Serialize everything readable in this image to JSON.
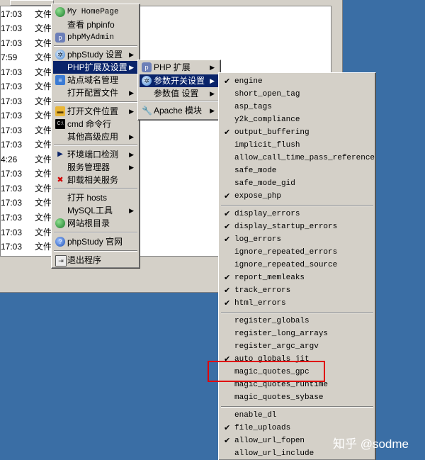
{
  "background": {
    "rows": [
      {
        "time": "17:03",
        "type": "文件"
      },
      {
        "time": "17:03",
        "type": "文件"
      },
      {
        "time": "17:03",
        "type": "文件"
      },
      {
        "time": "7:59",
        "type": "文件"
      },
      {
        "time": "17:03",
        "type": "文件"
      },
      {
        "time": "17:03",
        "type": "文件"
      },
      {
        "time": "17:03",
        "type": "文件"
      },
      {
        "time": "17:03",
        "type": "文件"
      },
      {
        "time": "17:03",
        "type": "文件"
      },
      {
        "time": "17:03",
        "type": "文件"
      },
      {
        "time": "4:26",
        "type": "文件"
      },
      {
        "time": "17:03",
        "type": "文件"
      },
      {
        "time": "17:03",
        "type": "文件"
      },
      {
        "time": "17:03",
        "type": "文件"
      },
      {
        "time": "17:03",
        "type": "文件"
      },
      {
        "time": "17:03",
        "type": "文件"
      },
      {
        "time": "17:03",
        "type": "文件"
      }
    ]
  },
  "main_menu": {
    "items": [
      {
        "label": "My HomePage",
        "icon": "globe-icon"
      },
      {
        "label": "查看 phpinfo",
        "icon": ""
      },
      {
        "label": "phpMyAdmin",
        "icon": "php-icon"
      },
      {
        "label": "phpStudy 设置",
        "icon": "gear-icon",
        "sub": true
      },
      {
        "label": "PHP扩展及设置",
        "icon": "",
        "sub": true,
        "highlight": true
      },
      {
        "label": "站点域名管理",
        "icon": "server-icon"
      },
      {
        "label": "打开配置文件",
        "icon": "",
        "sub": true
      },
      {
        "label": "打开文件位置",
        "icon": "folder-icon",
        "sub": true
      },
      {
        "label": "cmd 命令行",
        "icon": "cmd-icon"
      },
      {
        "label": "其他高级应用",
        "icon": "",
        "sub": true
      },
      {
        "label": "环境端口检测",
        "icon": "play-icon",
        "sub": true
      },
      {
        "label": "服务管理器",
        "icon": "",
        "sub": true
      },
      {
        "label": "卸载相关服务",
        "icon": "uninstall-icon"
      },
      {
        "label": "打开 hosts",
        "icon": ""
      },
      {
        "label": "MySQL工具",
        "icon": "",
        "sub": true
      },
      {
        "label": "网站根目录",
        "icon": "globe-icon"
      },
      {
        "label": "phpStudy 官网",
        "icon": "help-icon"
      },
      {
        "label": "退出程序",
        "icon": "exit-icon"
      }
    ]
  },
  "sub_menu": {
    "items": [
      {
        "label": "PHP 扩展",
        "icon": "php-icon",
        "sub": true
      },
      {
        "label": "参数开关设置",
        "icon": "gear-icon",
        "sub": true,
        "highlight": true
      },
      {
        "label": "参数值 设置",
        "icon": "",
        "sub": true
      },
      {
        "label": "Apache 模块",
        "icon": "wrench-icon",
        "sub": true
      }
    ]
  },
  "switch_menu": {
    "items": [
      {
        "label": "engine",
        "checked": true
      },
      {
        "label": "short_open_tag",
        "checked": false
      },
      {
        "label": "asp_tags",
        "checked": false
      },
      {
        "label": "y2k_compliance",
        "checked": false
      },
      {
        "label": "output_buffering",
        "checked": true
      },
      {
        "label": "implicit_flush",
        "checked": false
      },
      {
        "label": "allow_call_time_pass_reference",
        "checked": false
      },
      {
        "label": "safe_mode",
        "checked": false
      },
      {
        "label": "safe_mode_gid",
        "checked": false
      },
      {
        "label": "expose_php",
        "checked": true
      },
      {
        "label": "display_errors",
        "checked": true
      },
      {
        "label": "display_startup_errors",
        "checked": true
      },
      {
        "label": "log_errors",
        "checked": true
      },
      {
        "label": "ignore_repeated_errors",
        "checked": false
      },
      {
        "label": "ignore_repeated_source",
        "checked": false
      },
      {
        "label": "report_memleaks",
        "checked": true
      },
      {
        "label": "track_errors",
        "checked": true
      },
      {
        "label": "html_errors",
        "checked": true
      },
      {
        "label": "register_globals",
        "checked": false
      },
      {
        "label": "register_long_arrays",
        "checked": false
      },
      {
        "label": "register_argc_argv",
        "checked": false
      },
      {
        "label": "auto_globals_jit",
        "checked": true
      },
      {
        "label": "magic_quotes_gpc",
        "checked": false
      },
      {
        "label": "magic_quotes_runtime",
        "checked": false
      },
      {
        "label": "magic_quotes_sybase",
        "checked": false
      },
      {
        "label": "enable_dl",
        "checked": false
      },
      {
        "label": "file_uploads",
        "checked": true
      },
      {
        "label": "allow_url_fopen",
        "checked": true
      },
      {
        "label": "allow_url_include",
        "checked": false
      }
    ]
  },
  "watermark": "知乎 @sodme",
  "colors": {
    "highlight": "#0a246a",
    "annotation": "#e00000",
    "desktop": "#3a6ea5"
  }
}
